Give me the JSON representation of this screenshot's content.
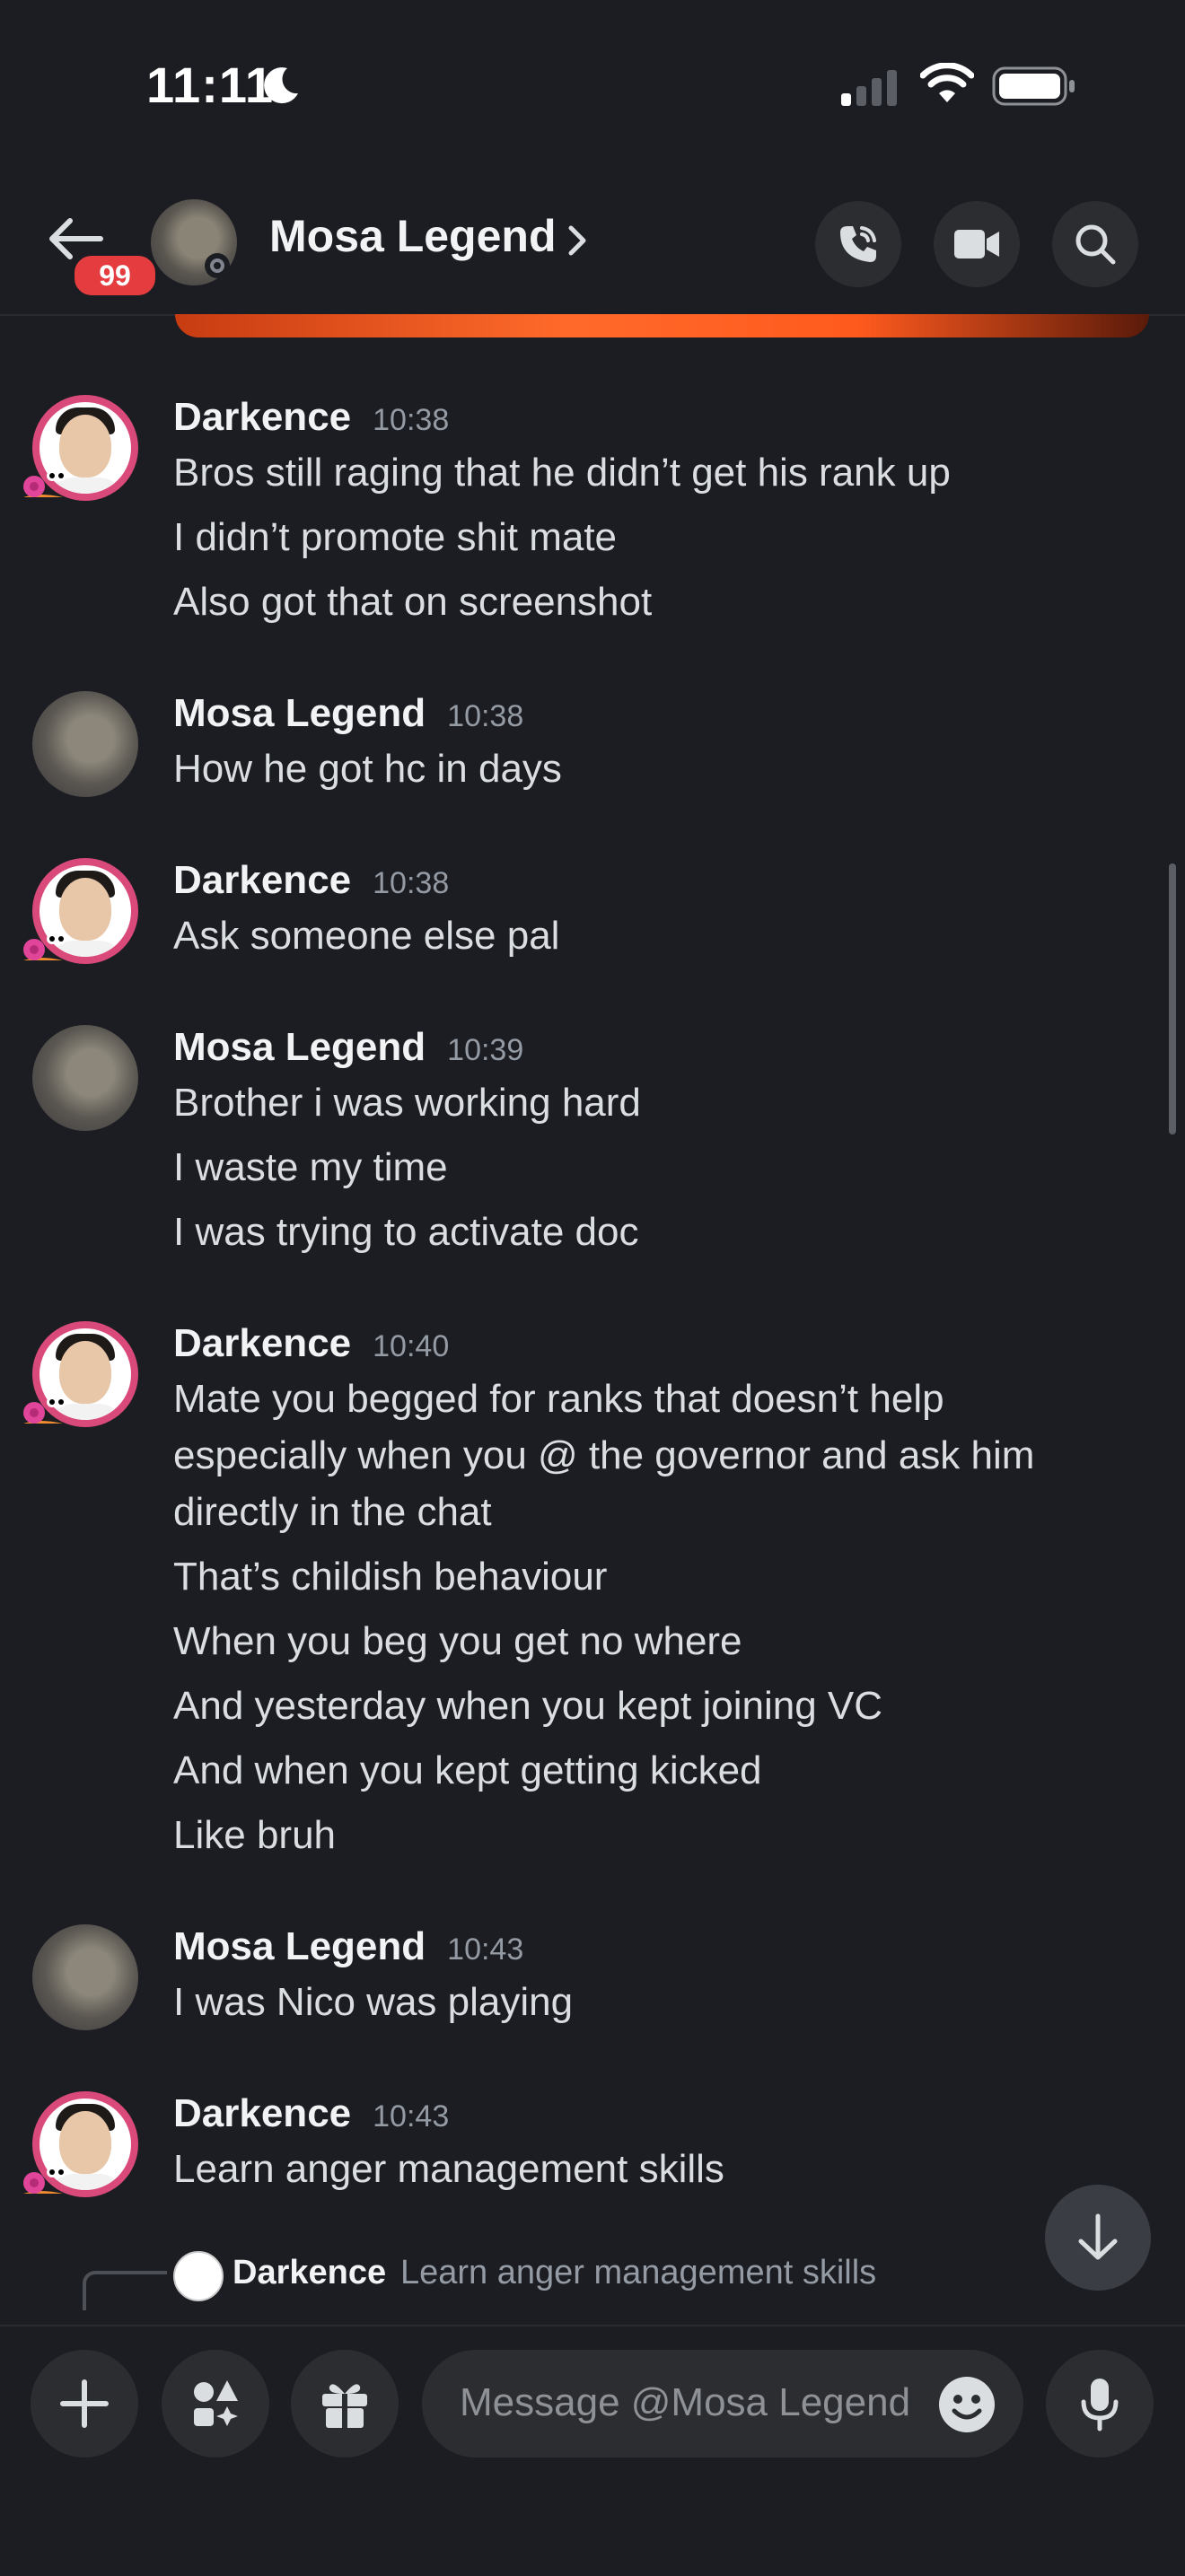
{
  "status_bar": {
    "time": "11:11"
  },
  "header": {
    "badge": "99",
    "title": "Mosa Legend"
  },
  "messages": [
    {
      "author": "Darkence",
      "time": "10:38",
      "lines": [
        "Bros still raging that he didn’t get his rank up",
        "I didn’t promote shit mate",
        "Also got that on screenshot"
      ]
    },
    {
      "author": "Mosa Legend",
      "time": "10:38",
      "lines": [
        "How he got hc in days"
      ]
    },
    {
      "author": "Darkence",
      "time": "10:38",
      "lines": [
        "Ask someone else pal"
      ]
    },
    {
      "author": "Mosa Legend",
      "time": "10:39",
      "lines": [
        "Brother i was working hard",
        "I waste my time",
        "I was trying to activate doc"
      ]
    },
    {
      "author": "Darkence",
      "time": "10:40",
      "lines": [
        "Mate you begged for ranks that doesn’t help",
        "especially when you @ the governor and ask him",
        "directly in the chat",
        "That’s childish behaviour",
        "When you beg you get no where",
        "And yesterday when you kept joining VC",
        "And when you kept getting kicked",
        "Like bruh"
      ]
    },
    {
      "author": "Mosa Legend",
      "time": "10:43",
      "lines": [
        "I was Nico was playing"
      ]
    },
    {
      "author": "Darkence",
      "time": "10:43",
      "lines": [
        "Learn anger management skills"
      ]
    }
  ],
  "reply_preview": {
    "author": "Darkence",
    "text": "Learn anger management skills"
  },
  "composer": {
    "placeholder": "Message @Mosa Legend"
  },
  "icons": [
    "back-arrow-icon",
    "chevron-right-icon",
    "phone-call-icon",
    "video-camera-icon",
    "search-icon",
    "arrow-down-icon",
    "plus-icon",
    "apps-icon",
    "gift-icon",
    "emoji-icon",
    "microphone-icon"
  ],
  "colors": {
    "background": "#1c1d22",
    "badge": "#e53c3f",
    "button": "#2b2d31",
    "muted_text": "#949ba4"
  }
}
